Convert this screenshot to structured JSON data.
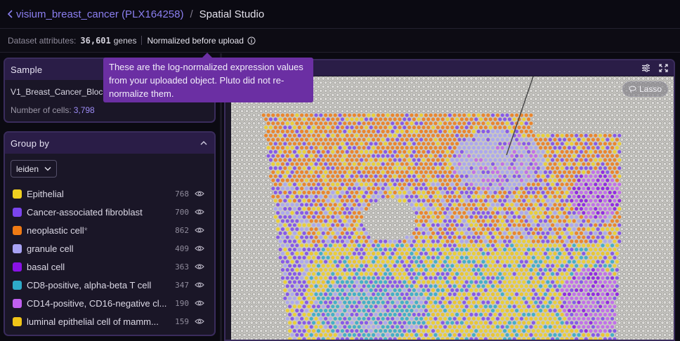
{
  "breadcrumb": {
    "project": "visium_breast_cancer (PLX164258)",
    "current": "Spatial Studio"
  },
  "attributes": {
    "label": "Dataset attributes:",
    "gene_count": "36,601",
    "genes_unit": "genes",
    "normalization": "Normalized before upload"
  },
  "tooltip": {
    "text": "These are the log-normalized expression values from your uploaded object. Pluto did not re-normalize them."
  },
  "sample": {
    "title": "Sample",
    "name": "V1_Breast_Cancer_Block",
    "cells_label": "Number of cells:",
    "cells_value": "3,798"
  },
  "group_by": {
    "title": "Group by",
    "selected": "leiden",
    "items": [
      {
        "label": "Epithelial",
        "count": "768",
        "color": "#f0d020",
        "suffix": ""
      },
      {
        "label": "Cancer-associated fibroblast",
        "count": "700",
        "color": "#7b45ee",
        "suffix": ""
      },
      {
        "label": "neoplastic cell",
        "count": "862",
        "color": "#f07a14",
        "suffix": "*"
      },
      {
        "label": "granule cell",
        "count": "409",
        "color": "#a8a2f4",
        "suffix": ""
      },
      {
        "label": "basal cell",
        "count": "363",
        "color": "#8a12e6",
        "suffix": ""
      },
      {
        "label": "CD8-positive, alpha-beta T cell",
        "count": "347",
        "color": "#2eaac8",
        "suffix": ""
      },
      {
        "label": "CD14-positive, CD16-negative cl...",
        "count": "190",
        "color": "#c060f0",
        "suffix": ""
      },
      {
        "label": "luminal epithelial cell of mamm...",
        "count": "159",
        "color": "#f0c418",
        "suffix": ""
      }
    ]
  },
  "viewer": {
    "lasso_label": "Lasso",
    "icons": [
      "sliders-icon",
      "fullscreen-icon",
      "lasso-icon"
    ]
  }
}
